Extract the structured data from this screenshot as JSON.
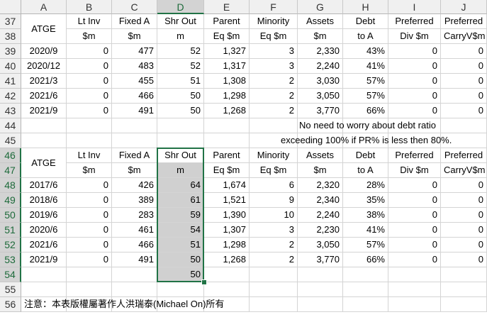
{
  "columns": [
    "A",
    "B",
    "C",
    "D",
    "E",
    "F",
    "G",
    "H",
    "I",
    "J"
  ],
  "selected_column": "D",
  "rows": [
    "37",
    "38",
    "39",
    "40",
    "41",
    "42",
    "43",
    "44",
    "45",
    "46",
    "47",
    "48",
    "49",
    "50",
    "51",
    "52",
    "53",
    "54",
    "55",
    "56"
  ],
  "selected_rows": [
    "46",
    "47",
    "48",
    "49",
    "50",
    "51",
    "52",
    "53",
    "54"
  ],
  "table1": {
    "label": "ATGE",
    "header_top": [
      "Lt Inv",
      "Fixed A",
      "Shr Out",
      "Parent",
      "Minority",
      "Assets",
      "Debt",
      "Preferred",
      "Preferred"
    ],
    "header_bottom": [
      "$m",
      "$m",
      "m",
      "Eq $m",
      "Eq $m",
      "$m",
      "to A",
      "Div $m",
      "CarryV$m"
    ],
    "data": [
      [
        "2020/9",
        "0",
        "477",
        "52",
        "1,327",
        "3",
        "2,330",
        "43%",
        "0",
        "0"
      ],
      [
        "2020/12",
        "0",
        "483",
        "52",
        "1,317",
        "3",
        "2,240",
        "41%",
        "0",
        "0"
      ],
      [
        "2021/3",
        "0",
        "455",
        "51",
        "1,308",
        "2",
        "3,030",
        "57%",
        "0",
        "0"
      ],
      [
        "2021/6",
        "0",
        "466",
        "50",
        "1,298",
        "2",
        "3,050",
        "57%",
        "0",
        "0"
      ],
      [
        "2021/9",
        "0",
        "491",
        "50",
        "1,268",
        "2",
        "3,770",
        "66%",
        "0",
        "0"
      ]
    ]
  },
  "note_line1": "No need to worry about debt ratio",
  "note_line2": "exceeding 100% if PR% is less then 80%.",
  "table2": {
    "label": "ATGE",
    "header_top": [
      "Lt Inv",
      "Fixed A",
      "Shr Out",
      "Parent",
      "Minority",
      "Assets",
      "Debt",
      "Preferred",
      "Preferred"
    ],
    "header_bottom": [
      "$m",
      "$m",
      "m",
      "Eq $m",
      "Eq $m",
      "$m",
      "to A",
      "Div $m",
      "CarryV$m"
    ],
    "data": [
      [
        "2017/6",
        "0",
        "426",
        "64",
        "1,674",
        "6",
        "2,320",
        "28%",
        "0",
        "0"
      ],
      [
        "2018/6",
        "0",
        "389",
        "61",
        "1,521",
        "9",
        "2,340",
        "35%",
        "0",
        "0"
      ],
      [
        "2019/6",
        "0",
        "283",
        "59",
        "1,390",
        "10",
        "2,240",
        "38%",
        "0",
        "0"
      ],
      [
        "2020/6",
        "0",
        "461",
        "54",
        "1,307",
        "3",
        "2,230",
        "41%",
        "0",
        "0"
      ],
      [
        "2021/6",
        "0",
        "466",
        "51",
        "1,298",
        "2",
        "3,050",
        "57%",
        "0",
        "0"
      ],
      [
        "2021/9",
        "0",
        "491",
        "50",
        "1,268",
        "2",
        "3,770",
        "66%",
        "0",
        "0"
      ]
    ],
    "extra_d54": "50"
  },
  "footer_note": "注意：本表版權屬著作人洪瑞泰(Michael On)所有",
  "colors": {
    "selection": "#217346",
    "shade": "#d0d0d0",
    "header_bg": "#f0f0f0"
  }
}
